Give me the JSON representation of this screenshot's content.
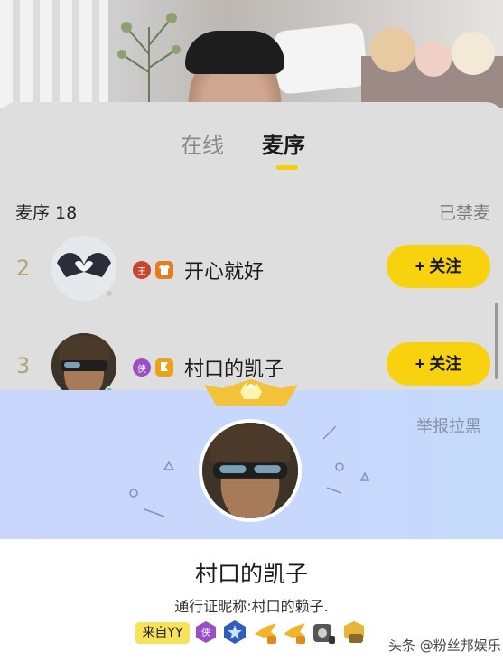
{
  "tabs": {
    "online": "在线",
    "queue": "麦序"
  },
  "queue_header": "麦序 18",
  "mic_status": "已禁麦",
  "rows": [
    {
      "rank": "2",
      "name": "开心就好",
      "follow": "+ 关注"
    },
    {
      "rank": "3",
      "name": "村口的凯子",
      "follow": "+ 关注"
    }
  ],
  "card": {
    "report": "举报拉黑",
    "name": "村口的凯子",
    "nickname": "通行证昵称:村口的赖子.",
    "from": "来自YY"
  },
  "watermark": "头条 @粉丝邦娱乐",
  "colors": {
    "accent": "#f8d20f",
    "rank": "#b4a27a"
  }
}
